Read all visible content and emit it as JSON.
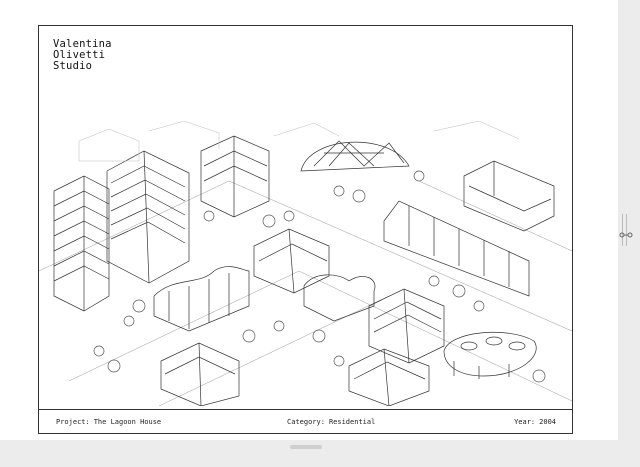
{
  "studio": {
    "name_lines": [
      "Valentina",
      "Olivetti",
      "Studio"
    ]
  },
  "footer": {
    "project_key": "Project:",
    "project_value": "The Lagoon House",
    "category_key": "Category:",
    "category_value": "Residential",
    "year_key": "Year:",
    "year_value": "2004"
  },
  "icons": {
    "resize": "drag-handle-icon",
    "bottom": "drag-handle-icon"
  },
  "colors": {
    "background": "#ececec",
    "sheet": "#ffffff",
    "ink": "#222222"
  }
}
